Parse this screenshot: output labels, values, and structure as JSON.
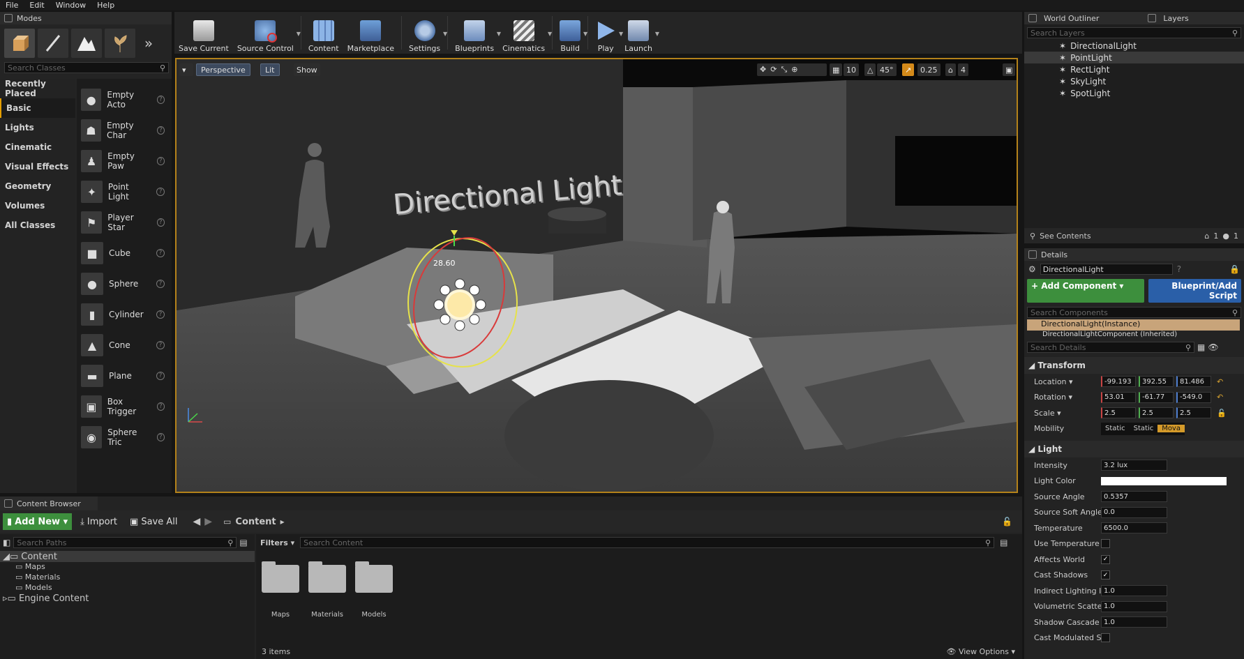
{
  "menu": [
    "File",
    "Edit",
    "Window",
    "Help"
  ],
  "modes": {
    "title": "Modes",
    "search_placeholder": "Search Classes",
    "categories": [
      "Recently Placed",
      "Basic",
      "Lights",
      "Cinematic",
      "Visual Effects",
      "Geometry",
      "Volumes",
      "All Classes"
    ],
    "items": [
      "Empty Acto",
      "Empty Char",
      "Empty Paw",
      "Point Light",
      "Player Star",
      "Cube",
      "Sphere",
      "Cylinder",
      "Cone",
      "Plane",
      "Box Trigger",
      "Sphere Tric"
    ]
  },
  "toolbar": {
    "save_current": "Save Current",
    "source_control": "Source Control",
    "content": "Content",
    "marketplace": "Marketplace",
    "settings": "Settings",
    "blueprints": "Blueprints",
    "cinematics": "Cinematics",
    "build": "Build",
    "play": "Play",
    "launch": "Launch"
  },
  "viewport": {
    "perspective": "Perspective",
    "lit": "Lit",
    "show": "Show",
    "grid_snap": "10",
    "rot_snap": "45°",
    "scale_snap": "0.25",
    "camera_speed": "4",
    "scene_text": "Directional Light",
    "gizmo_readout": "28.60"
  },
  "outliner": {
    "tab1": "World Outliner",
    "tab2": "Layers",
    "search_placeholder": "Search Layers",
    "items": [
      "DirectionalLight",
      "PointLight",
      "RectLight",
      "SkyLight",
      "SpotLight"
    ],
    "see_contents": "See Contents",
    "count_a": "1",
    "count_b": "1"
  },
  "details": {
    "tab": "Details",
    "name_value": "DirectionalLight",
    "add_component": "+ Add Component ▾",
    "blueprint_script": "Blueprint/Add Script",
    "search_components": "Search Components",
    "instance": "DirectionalLight(Instance)",
    "component": "DirectionalLightComponent (Inherited)",
    "search_details": "Search Details",
    "transform": "Transform",
    "location_label": "Location ▾",
    "location": [
      "-99.193",
      "392.55",
      "81.486"
    ],
    "rotation_label": "Rotation ▾",
    "rotation": [
      "53.01",
      "-61.77",
      "-549.0"
    ],
    "scale_label": "Scale ▾",
    "scale": [
      "2.5",
      "2.5",
      "2.5"
    ],
    "mobility_label": "Mobility",
    "mobility": [
      "Static",
      "Static",
      "Mova"
    ],
    "light": "Light",
    "props": [
      {
        "label": "Intensity",
        "value": "3.2 lux"
      },
      {
        "label": "Light Color",
        "value": ""
      },
      {
        "label": "Source Angle",
        "value": "0.5357"
      },
      {
        "label": "Source Soft Angle",
        "value": "0.0"
      },
      {
        "label": "Temperature",
        "value": "6500.0"
      }
    ],
    "checks": [
      {
        "label": "Use Temperature",
        "checked": false
      },
      {
        "label": "Affects World",
        "checked": true
      },
      {
        "label": "Cast Shadows",
        "checked": true
      }
    ],
    "props2": [
      {
        "label": "Indirect Lighting Int",
        "value": "1.0"
      },
      {
        "label": "Volumetric Scatteri",
        "value": "1.0"
      },
      {
        "label": "Shadow Cascade Bi",
        "value": "1.0"
      }
    ],
    "last_label": "Cast Modulated Sh"
  },
  "content_browser": {
    "tab": "Content Browser",
    "add_new": "Add New ▾",
    "import": "Import",
    "save_all": "Save All",
    "path": "Content",
    "search_paths": "Search Paths",
    "filters": "Filters ▾",
    "search_content": "Search Content",
    "tree": [
      "Content",
      "Maps",
      "Materials",
      "Models",
      "Engine Content"
    ],
    "folders": [
      "Maps",
      "Materials",
      "Models"
    ],
    "item_count": "3 items",
    "view_options": "View Options ▾"
  }
}
